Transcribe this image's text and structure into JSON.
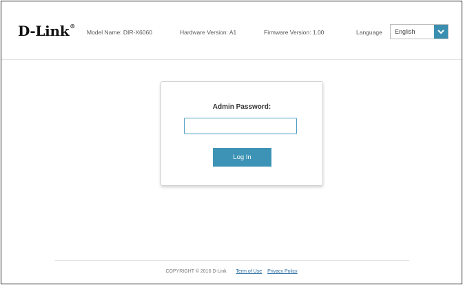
{
  "header": {
    "logo": "D-Link",
    "logo_mark": "®",
    "model": "Model Name: DIR-X6060",
    "hardware": "Hardware Version: A1",
    "firmware": "Firmware Version: 1.00",
    "language_label": "Language",
    "language_value": "English"
  },
  "login": {
    "title": "Admin Password:",
    "password_value": "",
    "button_label": "Log In"
  },
  "footer": {
    "copyright": "COPYRIGHT © 2016 D-Link",
    "terms": "Term of Use",
    "privacy": "Privacy Policy"
  },
  "colors": {
    "accent": "#3d93b5",
    "input_border": "#4d9bc4"
  },
  "icons": {
    "language_dropdown": "chevron-down-icon"
  }
}
